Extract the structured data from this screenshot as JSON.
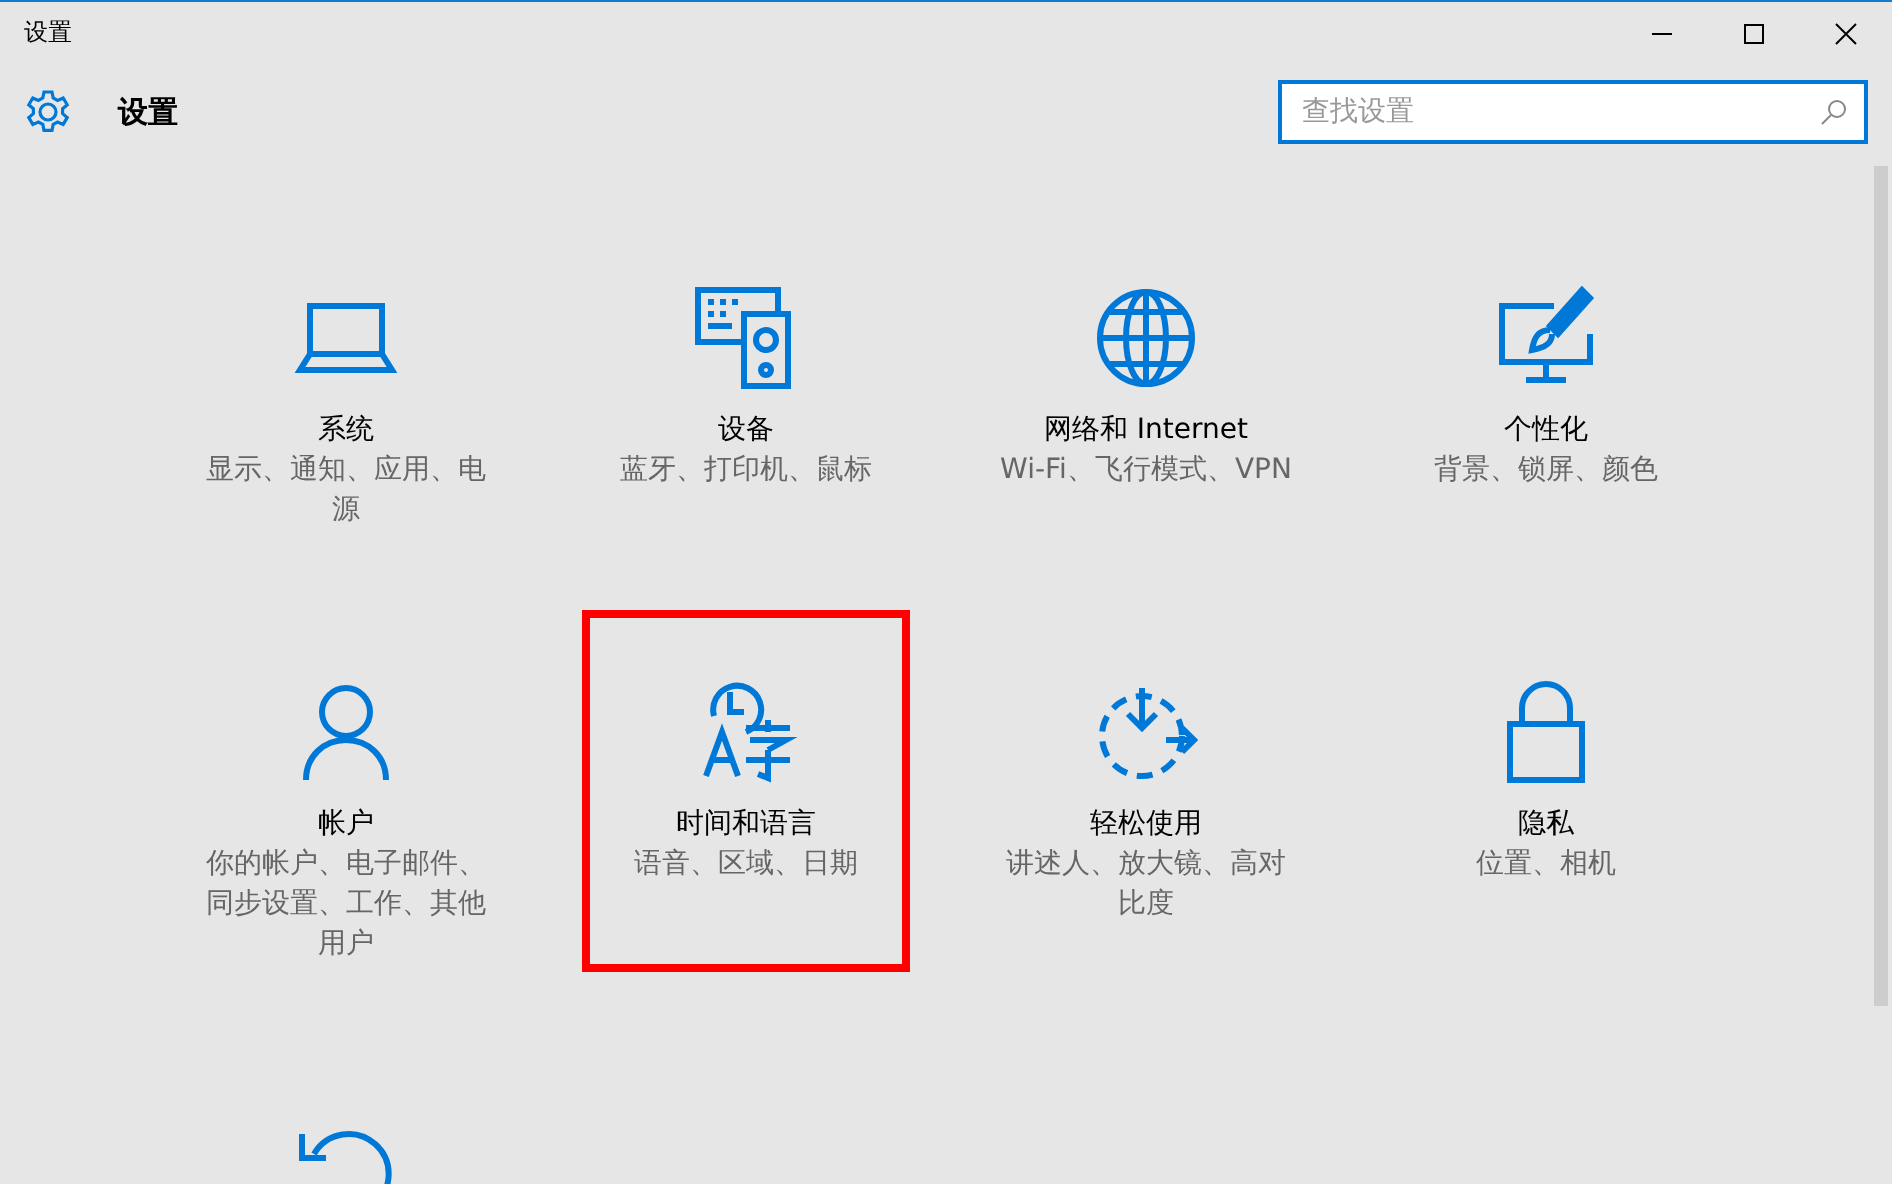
{
  "window": {
    "title": "设置"
  },
  "header": {
    "title": "设置",
    "search": {
      "placeholder": "查找设置"
    }
  },
  "items": [
    {
      "title": "系统",
      "description": "显示、通知、应用、电源",
      "highlighted": false
    },
    {
      "title": "设备",
      "description": "蓝牙、打印机、鼠标",
      "highlighted": false
    },
    {
      "title": "网络和 Internet",
      "description": "Wi-Fi、飞行模式、VPN",
      "highlighted": false
    },
    {
      "title": "个性化",
      "description": "背景、锁屏、颜色",
      "highlighted": false
    },
    {
      "title": "帐户",
      "description": "你的帐户、电子邮件、同步设置、工作、其他用户",
      "highlighted": false
    },
    {
      "title": "时间和语言",
      "description": "语音、区域、日期",
      "highlighted": true
    },
    {
      "title": "轻松使用",
      "description": "讲述人、放大镜、高对比度",
      "highlighted": false
    },
    {
      "title": "隐私",
      "description": "位置、相机",
      "highlighted": false
    },
    {
      "highlighted": false
    }
  ]
}
